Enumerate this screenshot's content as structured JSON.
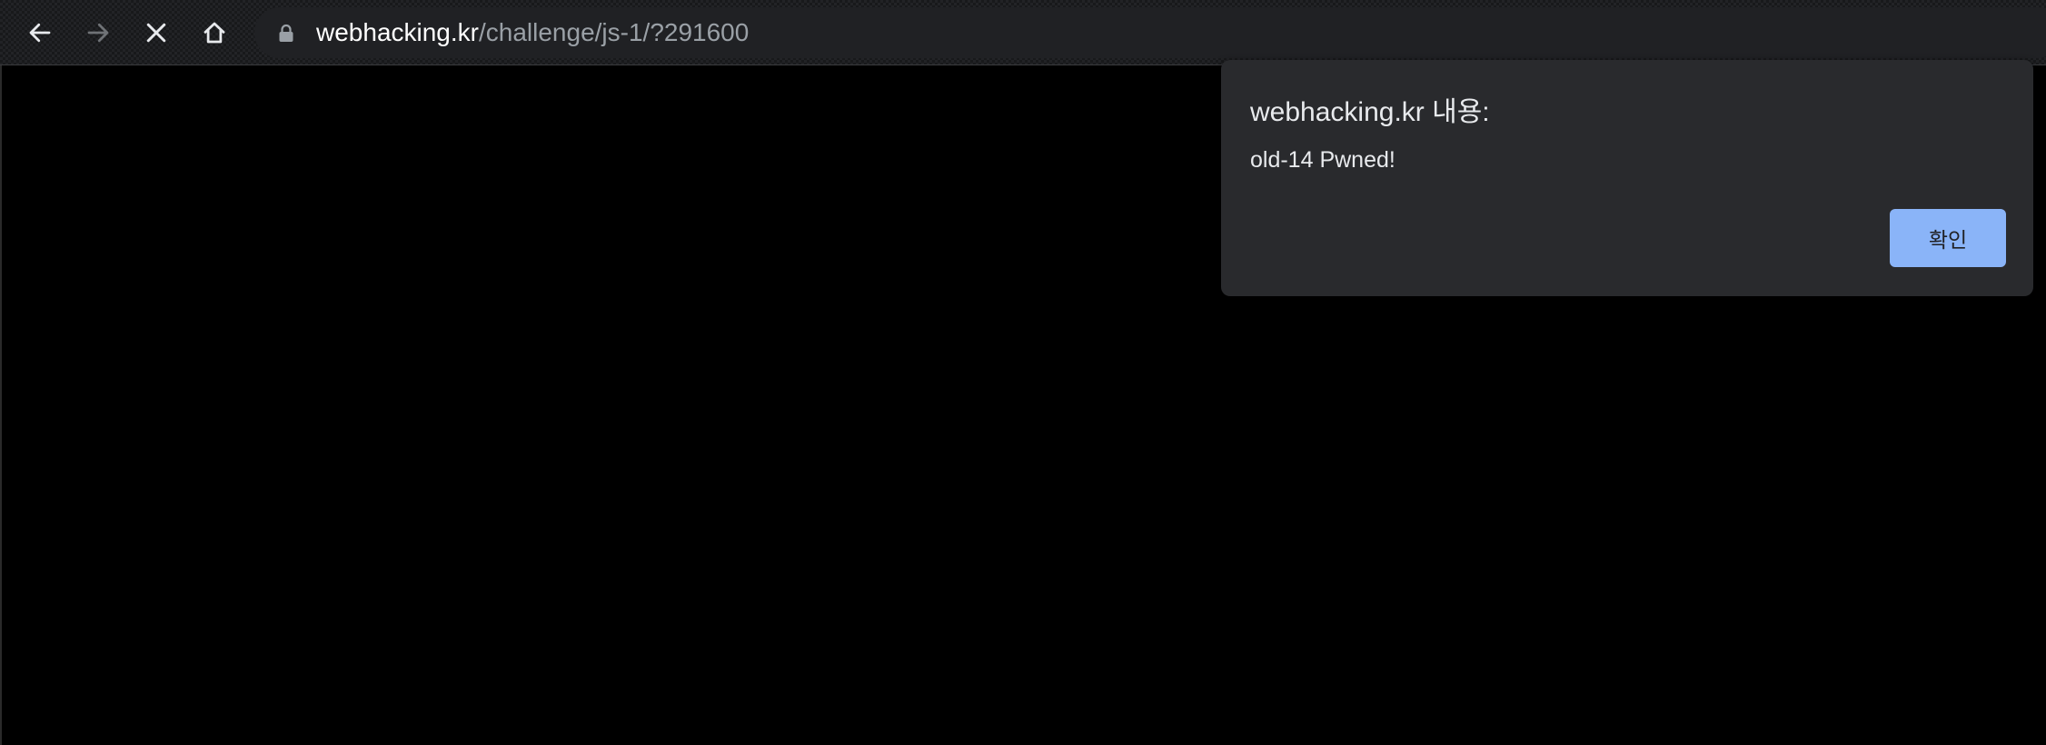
{
  "browser": {
    "toolbar": {
      "back_icon": "arrow-left-icon",
      "forward_icon": "arrow-right-icon",
      "stop_icon": "close-icon",
      "home_icon": "home-icon"
    },
    "omnibox": {
      "lock_icon": "lock-icon",
      "host": "webhacking.kr",
      "path": "/challenge/js-1/?291600"
    }
  },
  "dialog": {
    "title": "webhacking.kr 내용:",
    "message": "old-14 Pwned!",
    "ok_label": "확인"
  },
  "colors": {
    "toolbar_bg": "#18191b",
    "omnibox_bg": "#202124",
    "dialog_bg": "#292a2d",
    "accent": "#8ab4f8",
    "page_bg": "#000000"
  }
}
